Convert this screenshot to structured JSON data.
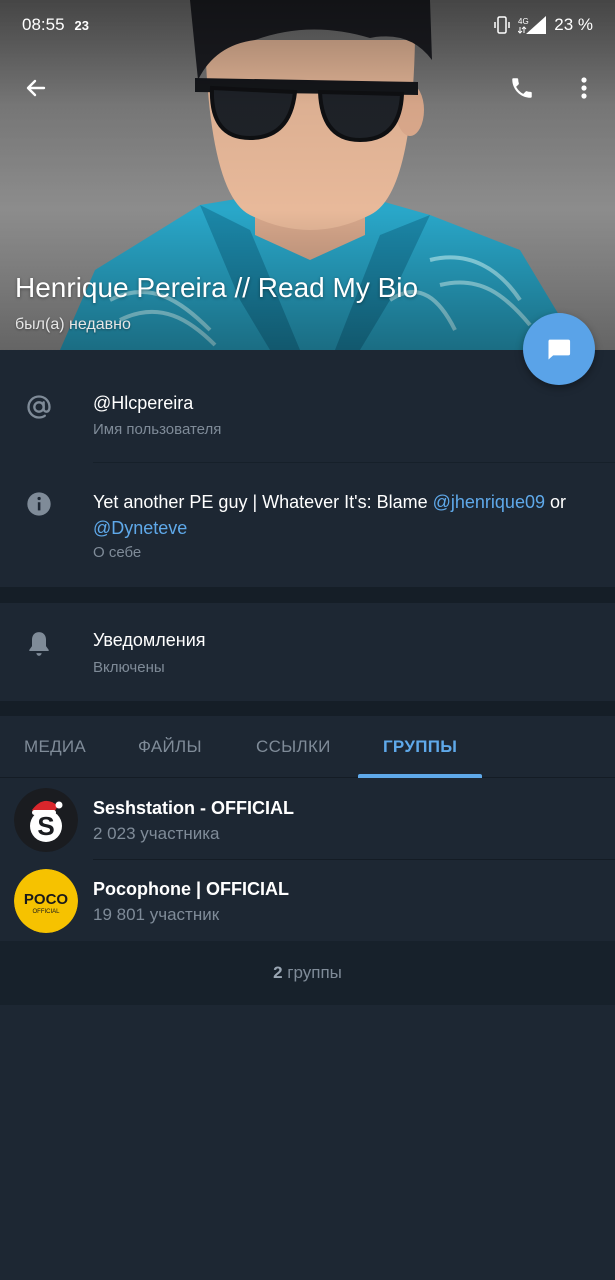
{
  "status_bar": {
    "time": "08:55",
    "notification": "23",
    "battery": "23 %",
    "network": "4G"
  },
  "header": {
    "back_icon": "arrow-left-icon",
    "call_icon": "phone-icon",
    "more_icon": "more-vert-icon"
  },
  "profile": {
    "name": "Henrique Pereira // Read My Bio",
    "status": "был(а) недавно"
  },
  "fab": {
    "icon": "message-icon"
  },
  "info": {
    "username": "@Hlcpereira",
    "username_label": "Имя пользователя",
    "bio_prefix": "Yet another PE guy | Whatever It's: Blame ",
    "bio_link1": "@jhenrique09",
    "bio_mid": " or",
    "bio_link2": "@Dyneteve",
    "bio_label": "О себе"
  },
  "notifications": {
    "title": "Уведомления",
    "value": "Включены"
  },
  "tabs": [
    {
      "label": "МЕДИА",
      "active": false
    },
    {
      "label": "ФАЙЛЫ",
      "active": false
    },
    {
      "label": "ССЫЛКИ",
      "active": false
    },
    {
      "label": "ГРУППЫ",
      "active": true
    }
  ],
  "groups": [
    {
      "title": "Seshstation - OFFICIAL",
      "count": "2 023 участника"
    },
    {
      "title": "Pocophone | OFFICIAL",
      "count": "19 801 участник",
      "avatar_text": "POCO",
      "avatar_subtext": "OFFICIAL"
    }
  ],
  "groups_footer": {
    "count": "2",
    "label": " группы"
  },
  "colors": {
    "background": "#1d2733",
    "accent": "#5fa9ea",
    "fab": "#5aa3e8",
    "secondary_text": "#7f8b98"
  }
}
